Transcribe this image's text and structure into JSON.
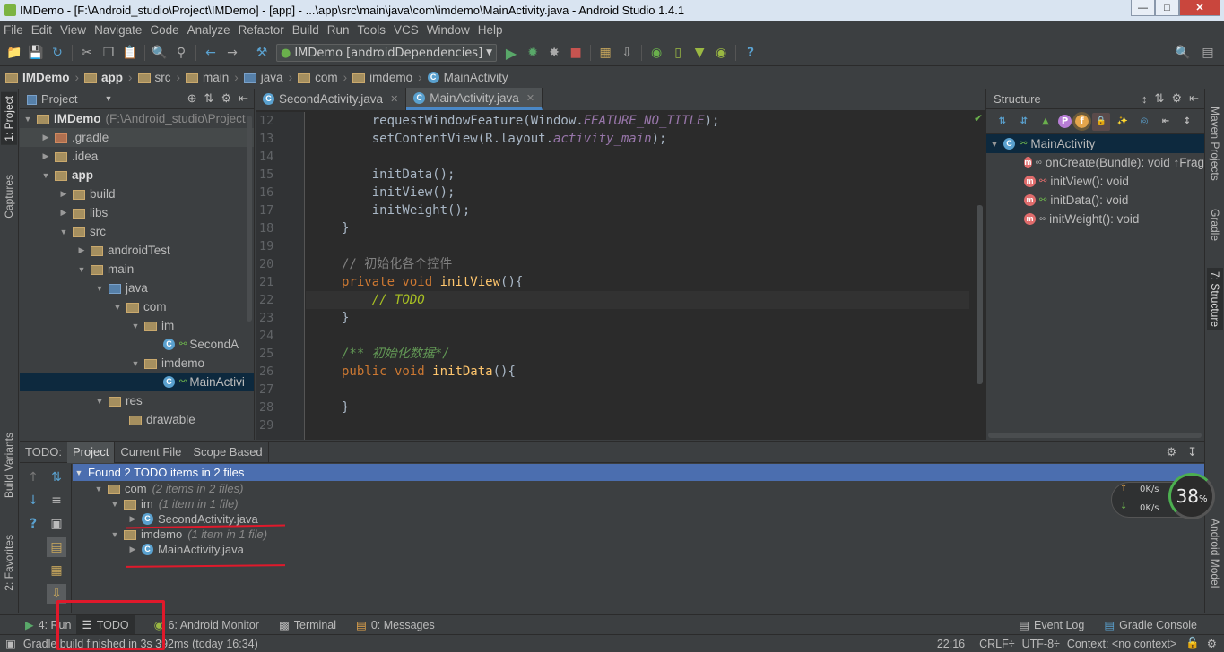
{
  "window": {
    "title": "IMDemo - [F:\\Android_studio\\Project\\IMDemo] - [app] - ...\\app\\src\\main\\java\\com\\imdemo\\MainActivity.java - Android Studio 1.4.1"
  },
  "menu": [
    "File",
    "Edit",
    "View",
    "Navigate",
    "Code",
    "Analyze",
    "Refactor",
    "Build",
    "Run",
    "Tools",
    "VCS",
    "Window",
    "Help"
  ],
  "toolbar": {
    "run_config": "IMDemo [androidDependencies]"
  },
  "breadcrumbs": [
    "IMDemo",
    "app",
    "src",
    "main",
    "java",
    "com",
    "imdemo",
    "MainActivity"
  ],
  "left_tabs": {
    "project": "1: Project",
    "captures": "Captures",
    "build_variants": "Build Variants",
    "favorites": "2: Favorites"
  },
  "right_tabs": {
    "maven": "Maven Projects",
    "gradle": "Gradle",
    "structure": "7: Structure",
    "android_model": "Android Model"
  },
  "project_panel": {
    "title": "Project",
    "root": "IMDemo",
    "root_path": "(F:\\Android_studio\\Project",
    "items": [
      ".gradle",
      ".idea",
      "app",
      "build",
      "libs",
      "src",
      "androidTest",
      "main",
      "java",
      "com",
      "im",
      "SecondA",
      "imdemo",
      "MainActivi",
      "res",
      "drawable"
    ]
  },
  "editor": {
    "tabs": [
      "SecondActivity.java",
      "MainActivity.java"
    ],
    "line_numbers": [
      "12",
      "13",
      "14",
      "15",
      "16",
      "17",
      "18",
      "19",
      "20",
      "21",
      "22",
      "23",
      "24",
      "25",
      "26",
      "27",
      "28",
      "29"
    ],
    "code": {
      "l12a": "requestWindowFeature(Window.",
      "l12b": "FEATURE_NO_TITLE",
      "l12c": ");",
      "l13a": "setContentView(R.layout.",
      "l13b": "activity_main",
      "l13c": ");",
      "l15": "initData();",
      "l16": "initView();",
      "l17": "initWeight();",
      "l18": "}",
      "l20": "// 初始化各个控件",
      "l21a": "private void ",
      "l21b": "initView",
      "l21c": "(){",
      "l22a": "// ",
      "l22b": "TODO",
      "l23": "}",
      "l25": "/** 初始化数据*/",
      "l26a": "public void ",
      "l26b": "initData",
      "l26c": "(){",
      "l28": "}"
    }
  },
  "structure": {
    "title": "Structure",
    "class_name": "MainActivity",
    "members": [
      "onCreate(Bundle): void ↑Frag",
      "initView(): void",
      "initData(): void",
      "initWeight(): void"
    ]
  },
  "todo": {
    "label": "TODO:",
    "tabs": [
      "Project",
      "Current File",
      "Scope Based"
    ],
    "summary": "Found 2 TODO items in 2 files",
    "com": "com",
    "com_info": "(2 items in 2 files)",
    "im": "im",
    "im_info": "(1 item in 1 file)",
    "second": "SecondActivity.java",
    "imdemo": "imdemo",
    "imdemo_info": "(1 item in 1 file)",
    "main": "MainActivity.java"
  },
  "net": {
    "up": "0K/s",
    "down": "0K/s",
    "percent": "38",
    "pct_sign": "%"
  },
  "bottom_tabs": {
    "run": "4: Run",
    "todo": "TODO",
    "monitor": "6: Android Monitor",
    "terminal": "Terminal",
    "messages": "0: Messages",
    "event_log": "Event Log",
    "gradle_console": "Gradle Console"
  },
  "status": {
    "message": "Gradle build finished in 3s 392ms (today 16:34)",
    "position": "22:16",
    "line_sep": "CRLF÷",
    "encoding": "UTF-8÷",
    "context": "Context: <no context>"
  }
}
